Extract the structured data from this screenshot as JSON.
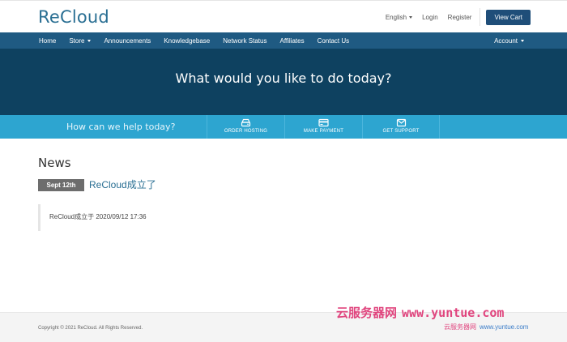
{
  "header": {
    "logo": "ReCloud",
    "language": "English",
    "login": "Login",
    "register": "Register",
    "cart": "View Cart"
  },
  "nav": {
    "items": [
      "Home",
      "Store",
      "Announcements",
      "Knowledgebase",
      "Network Status",
      "Affiliates",
      "Contact Us"
    ],
    "account": "Account"
  },
  "hero": {
    "title": "What would you like to do today?"
  },
  "actions": {
    "help_text": "How can we help today?",
    "order_hosting": "ORDER HOSTING",
    "make_payment": "MAKE PAYMENT",
    "get_support": "GET SUPPORT"
  },
  "news": {
    "heading": "News",
    "date": "Sept 12th",
    "title": "ReCloud成立了",
    "body": "ReCloud成立于 2020/09/12 17:36"
  },
  "footer": {
    "copyright": "Copyright © 2021 ReCloud. All Rights Reserved."
  },
  "watermark": {
    "cn": "云服务器网",
    "url": "www.yuntue.com",
    "small_cn": "云服务器网",
    "small_url": "www.yuntue.com"
  },
  "colors": {
    "nav": "#1f5a82",
    "hero": "#0e4160",
    "action_bar": "#2da5d0",
    "accent": "#2a6f93"
  }
}
